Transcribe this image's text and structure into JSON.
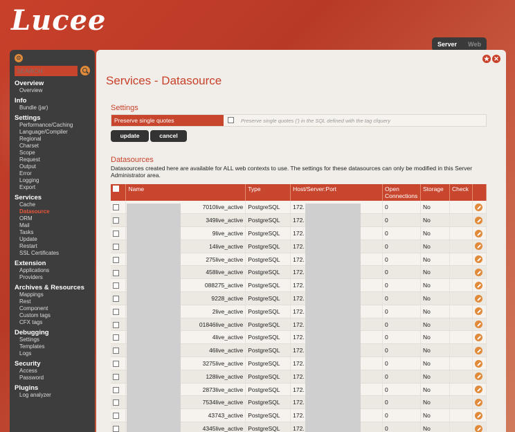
{
  "brand": {
    "logo_text": "Lucee"
  },
  "mode_tabs": {
    "server": "Server",
    "web": "Web"
  },
  "sidebar": {
    "search_placeholder": "SEARCH",
    "groups": [
      {
        "title": "Overview",
        "items": [
          "Overview"
        ]
      },
      {
        "title": "Info",
        "items": [
          "Bundle (jar)"
        ]
      },
      {
        "title": "Settings",
        "items": [
          "Performance/Caching",
          "Language/Compiler",
          "Regional",
          "Charset",
          "Scope",
          "Request",
          "Output",
          "Error",
          "Logging",
          "Export"
        ]
      },
      {
        "title": "Services",
        "items": [
          "Cache",
          "Datasource",
          "ORM",
          "Mail",
          "Tasks",
          "Update",
          "Restart",
          "SSL Certificates"
        ]
      },
      {
        "title": "Extension",
        "items": [
          "Applications",
          "Providers"
        ]
      },
      {
        "title": "Archives & Resources",
        "items": [
          "Mappings",
          "Rest",
          "Component",
          "Custom tags",
          "CFX tags"
        ]
      },
      {
        "title": "Debugging",
        "items": [
          "Settings",
          "Templates",
          "Logs"
        ]
      },
      {
        "title": "Security",
        "items": [
          "Access",
          "Password"
        ]
      },
      {
        "title": "Plugins",
        "items": [
          "Log analyzer"
        ]
      }
    ],
    "active_item": "Datasource"
  },
  "main": {
    "title": "Services - Datasource",
    "settings": {
      "heading": "Settings",
      "option_label": "Preserve single quotes",
      "option_desc": "Preserve single quotes (') in the SQL defined with the tag cfquery",
      "update_label": "update",
      "cancel_label": "cancel"
    },
    "datasources": {
      "heading": "Datasources",
      "description": "Datasources created here are available for ALL web contexts to use. The settings for these datasources can only be modified in this Server Administrator area.",
      "columns": [
        "Name",
        "Type",
        "Host/Server:Port",
        "Open Connections",
        "Storage",
        "Check"
      ],
      "rows": [
        {
          "name": "7010live_active",
          "type": "PostgreSQL",
          "host": "172.",
          "open": "0",
          "storage": "No"
        },
        {
          "name": "349live_active",
          "type": "PostgreSQL",
          "host": "172.",
          "open": "0",
          "storage": "No"
        },
        {
          "name": "9live_active",
          "type": "PostgreSQL",
          "host": "172.",
          "open": "0",
          "storage": "No"
        },
        {
          "name": "14live_active",
          "type": "PostgreSQL",
          "host": "172.",
          "open": "0",
          "storage": "No"
        },
        {
          "name": "275live_active",
          "type": "PostgreSQL",
          "host": "172.",
          "open": "0",
          "storage": "No"
        },
        {
          "name": "458live_active",
          "type": "PostgreSQL",
          "host": "172.",
          "open": "0",
          "storage": "No"
        },
        {
          "name": "088275_active",
          "type": "PostgreSQL",
          "host": "172.",
          "open": "0",
          "storage": "No"
        },
        {
          "name": "9228_active",
          "type": "PostgreSQL",
          "host": "172.",
          "open": "0",
          "storage": "No"
        },
        {
          "name": "2live_active",
          "type": "PostgreSQL",
          "host": "172.",
          "open": "0",
          "storage": "No"
        },
        {
          "name": "01846live_active",
          "type": "PostgreSQL",
          "host": "172.",
          "open": "0",
          "storage": "No"
        },
        {
          "name": "4live_active",
          "type": "PostgreSQL",
          "host": "172.",
          "open": "0",
          "storage": "No"
        },
        {
          "name": "46live_active",
          "type": "PostgreSQL",
          "host": "172.",
          "open": "0",
          "storage": "No"
        },
        {
          "name": "3275live_active",
          "type": "PostgreSQL",
          "host": "172.",
          "open": "0",
          "storage": "No"
        },
        {
          "name": "128live_active",
          "type": "PostgreSQL",
          "host": "172.",
          "open": "0",
          "storage": "No"
        },
        {
          "name": "2873live_active",
          "type": "PostgreSQL",
          "host": "172.",
          "open": "0",
          "storage": "No"
        },
        {
          "name": "7534live_active",
          "type": "PostgreSQL",
          "host": "172.",
          "open": "0",
          "storage": "No"
        },
        {
          "name": "43743_active",
          "type": "PostgreSQL",
          "host": "172.",
          "open": "0",
          "storage": "No"
        },
        {
          "name": "4345live_active",
          "type": "PostgreSQL",
          "host": "172.",
          "open": "0",
          "storage": "No"
        }
      ]
    }
  }
}
